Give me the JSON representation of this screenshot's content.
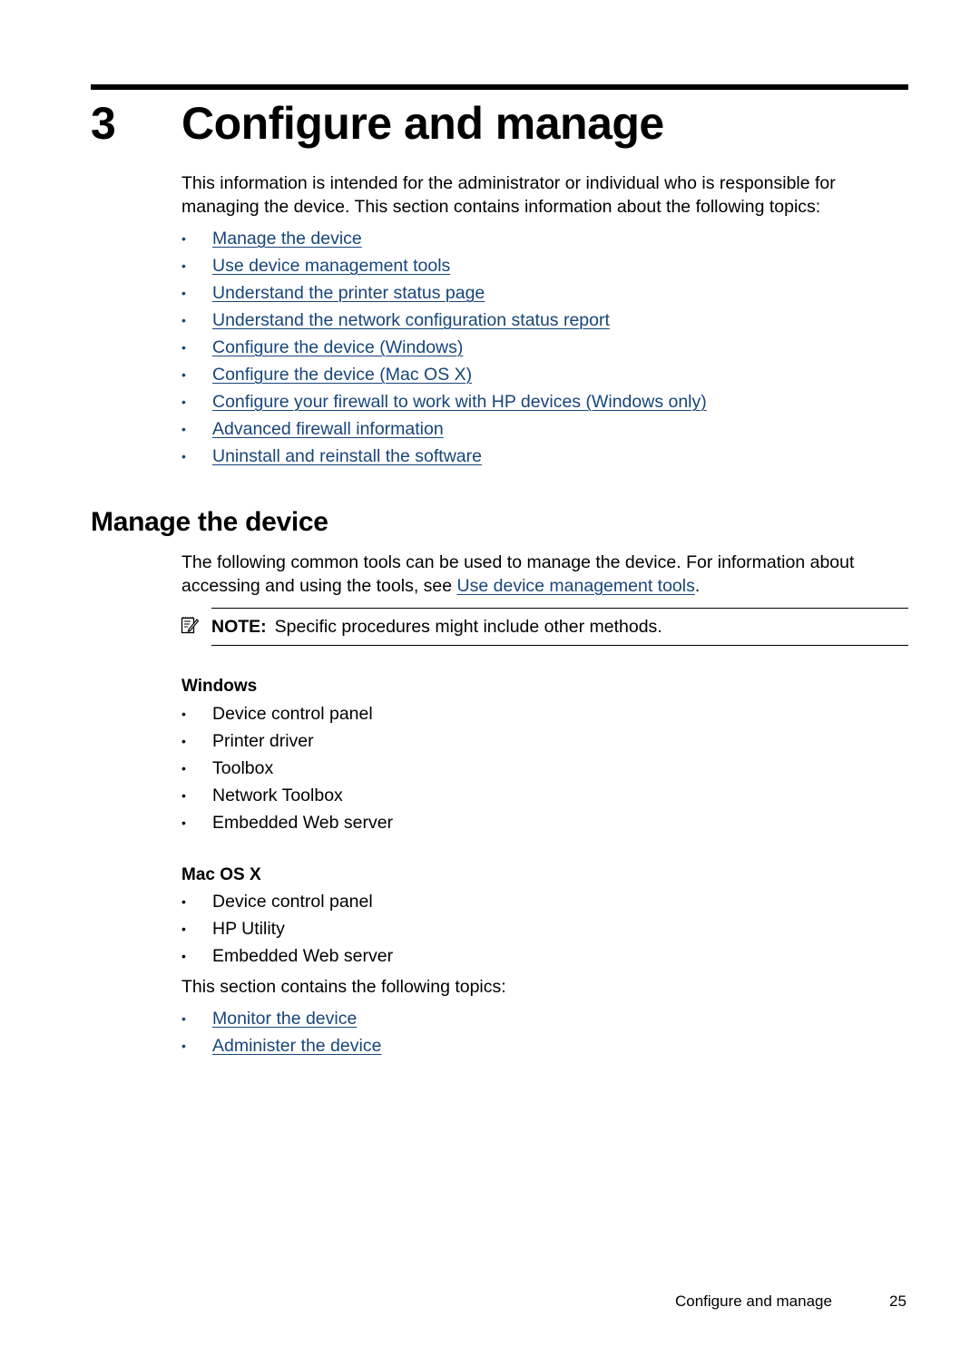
{
  "chapter": {
    "number": "3",
    "title": "Configure and manage"
  },
  "intro": {
    "paragraph": "This information is intended for the administrator or individual who is responsible for managing the device. This section contains information about the following topics:"
  },
  "topics": [
    {
      "label": "Manage the device"
    },
    {
      "label": "Use device management tools"
    },
    {
      "label": "Understand the printer status page"
    },
    {
      "label": "Understand the network configuration status report"
    },
    {
      "label": "Configure the device (Windows)"
    },
    {
      "label": "Configure the device (Mac OS X)"
    },
    {
      "label": "Configure your firewall to work with HP devices (Windows only)"
    },
    {
      "label": "Advanced firewall information"
    },
    {
      "label": "Uninstall and reinstall the software"
    }
  ],
  "section": {
    "heading": "Manage the device",
    "paragraph_before_link": "The following common tools can be used to manage the device. For information about accessing and using the tools, see ",
    "paragraph_link": "Use device management tools",
    "paragraph_after_link": ".",
    "note": {
      "icon": "note-pencil-icon",
      "label": "NOTE:",
      "text": "Specific procedures might include other methods."
    },
    "windows": {
      "heading": "Windows",
      "items": [
        "Device control panel",
        "Printer driver",
        "Toolbox",
        "Network Toolbox",
        "Embedded Web server"
      ]
    },
    "mac": {
      "heading": "Mac OS X",
      "items": [
        "Device control panel",
        "HP Utility",
        "Embedded Web server"
      ]
    },
    "topics_intro": "This section contains the following topics:",
    "subtopics": [
      {
        "label": "Monitor the device"
      },
      {
        "label": "Administer the device"
      }
    ]
  },
  "footer": {
    "title": "Configure and manage",
    "page": "25"
  },
  "colors": {
    "link": "#17457a",
    "text": "#000000"
  },
  "bullet_glyph": "•"
}
